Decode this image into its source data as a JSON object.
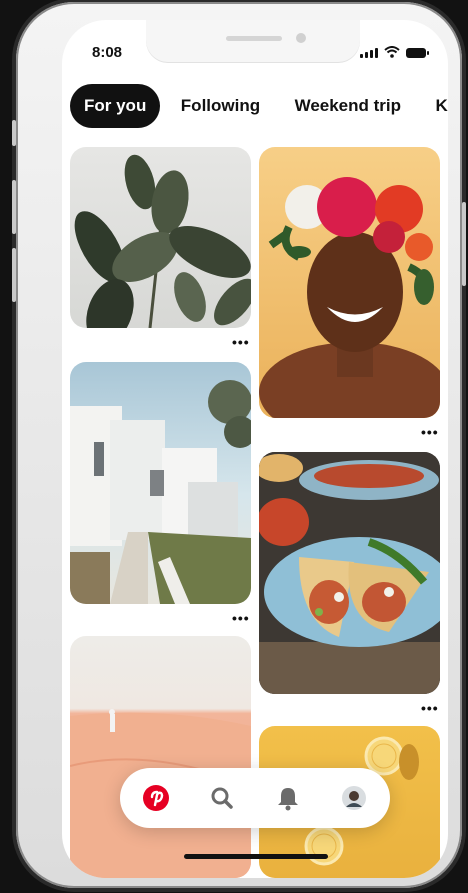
{
  "status": {
    "time": "8:08"
  },
  "tabs": [
    "For you",
    "Following",
    "Weekend trip",
    "Kitchen"
  ],
  "pins": [
    {
      "name": "rubber-plant"
    },
    {
      "name": "portrait-flower-crown"
    },
    {
      "name": "white-house"
    },
    {
      "name": "tacos"
    },
    {
      "name": "desert-dune"
    },
    {
      "name": "lemons"
    }
  ],
  "more_label": "•••",
  "nav": [
    "pinterest-icon",
    "search-icon",
    "bell-icon",
    "avatar"
  ],
  "colors": {
    "brand": "#e60023",
    "active_tab": "#111111"
  }
}
